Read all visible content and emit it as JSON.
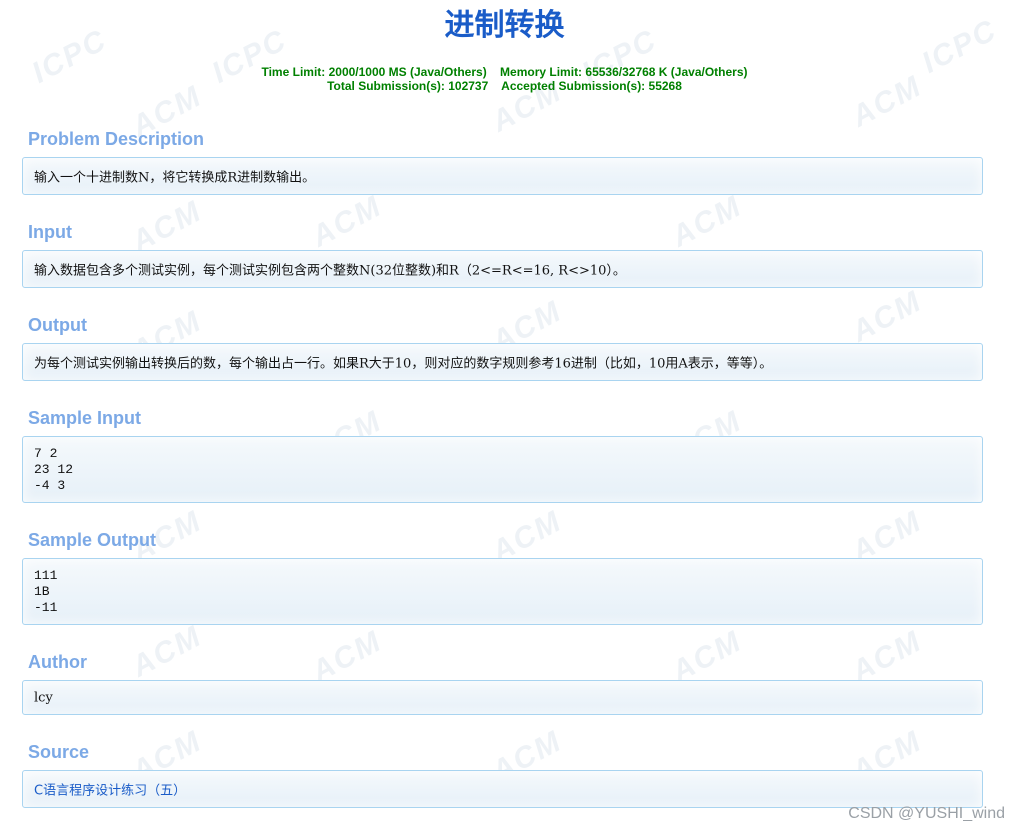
{
  "problem": {
    "title": "进制转换",
    "time_limit": "Time Limit: 2000/1000 MS (Java/Others)",
    "memory_limit": "Memory Limit: 65536/32768 K (Java/Others)",
    "total_submissions": "Total Submission(s): 102737",
    "accepted_submissions": "Accepted Submission(s): 55268"
  },
  "sections": {
    "description": {
      "heading": "Problem Description",
      "text": "输入一个十进制数N，将它转换成R进制数输出。"
    },
    "input": {
      "heading": "Input",
      "text": "输入数据包含多个测试实例，每个测试实例包含两个整数N(32位整数)和R（2<=R<=16, R<>10）。"
    },
    "output": {
      "heading": "Output",
      "text": "为每个测试实例输出转换后的数，每个输出占一行。如果R大于10，则对应的数字规则参考16进制（比如，10用A表示，等等）。"
    },
    "sample_input": {
      "heading": "Sample Input",
      "text": "7 2\n23 12\n-4 3"
    },
    "sample_output": {
      "heading": "Sample Output",
      "text": "111\n1B\n-11"
    },
    "author": {
      "heading": "Author",
      "text": "lcy"
    },
    "source": {
      "heading": "Source",
      "text": "C语言程序设计练习（五）"
    }
  },
  "watermark": {
    "text_acm": "ACM",
    "text_icpc": "ICPC",
    "credit": "CSDN @YUSHI_wind"
  },
  "colors": {
    "title": "#1a5cc8",
    "limits": "#008000",
    "section_heading": "#7ca9e6",
    "panel_border": "#a9d4f0",
    "panel_bg": "#e6f0f8",
    "link": "#1a5cc8"
  }
}
